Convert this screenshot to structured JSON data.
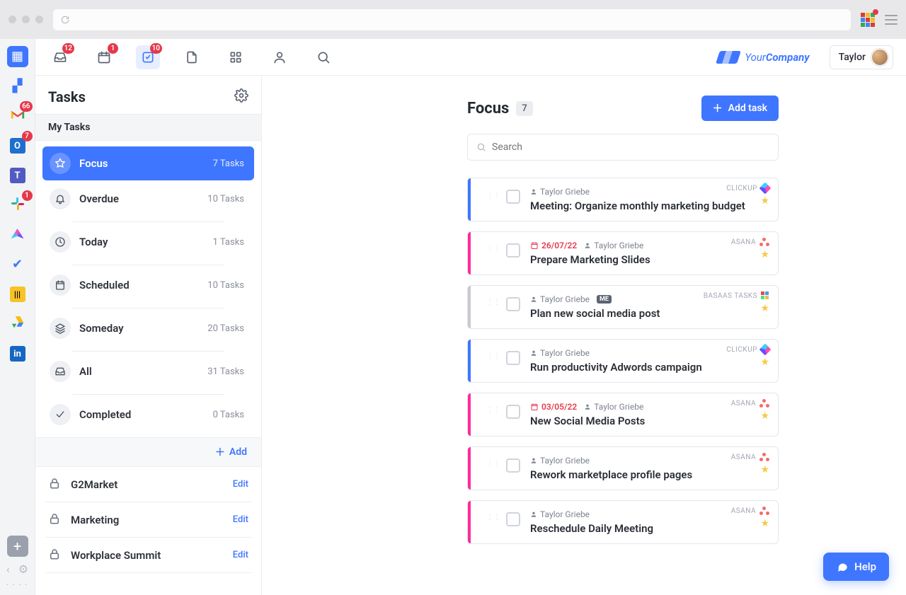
{
  "topbar": {
    "inbox_badge": "12",
    "calendar_badge": "1",
    "tasks_badge": "10",
    "brand_prefix": "Your",
    "brand_suffix": "Company",
    "user_name": "Taylor"
  },
  "rail": {
    "gmail_badge": "66",
    "outlook_badge": "7",
    "slack_badge": "1"
  },
  "sidebar": {
    "title": "Tasks",
    "section_label": "My Tasks",
    "add_label": "Add",
    "items": [
      {
        "label": "Focus",
        "count": "7 Tasks"
      },
      {
        "label": "Overdue",
        "count": "10 Tasks"
      },
      {
        "label": "Today",
        "count": "1 Tasks"
      },
      {
        "label": "Scheduled",
        "count": "10 Tasks"
      },
      {
        "label": "Someday",
        "count": "20 Tasks"
      },
      {
        "label": "All",
        "count": "31 Tasks"
      },
      {
        "label": "Completed",
        "count": "0 Tasks"
      }
    ],
    "projects": [
      {
        "name": "G2Market",
        "action": "Edit"
      },
      {
        "name": "Marketing",
        "action": "Edit"
      },
      {
        "name": "Workplace Summit",
        "action": "Edit"
      }
    ]
  },
  "content": {
    "title": "Focus",
    "count": "7",
    "add_task_label": "Add task",
    "search_placeholder": "Search",
    "tasks": [
      {
        "stripe": "blue",
        "assignee": "Taylor Griebe",
        "date": "",
        "me": false,
        "title": "Meeting: Organize monthly marketing budget",
        "source": "CLICKUP"
      },
      {
        "stripe": "pink",
        "assignee": "Taylor Griebe",
        "date": "26/07/22",
        "me": false,
        "title": "Prepare Marketing Slides",
        "source": "ASANA"
      },
      {
        "stripe": "gray",
        "assignee": "Taylor Griebe",
        "date": "",
        "me": true,
        "title": "Plan new social media post",
        "source": "BASAAS TASKS"
      },
      {
        "stripe": "blue",
        "assignee": "Taylor Griebe",
        "date": "",
        "me": false,
        "title": "Run productivity Adwords campaign",
        "source": "CLICKUP"
      },
      {
        "stripe": "pink",
        "assignee": "Taylor Griebe",
        "date": "03/05/22",
        "me": false,
        "title": "New Social Media Posts",
        "source": "ASANA"
      },
      {
        "stripe": "pink",
        "assignee": "Taylor Griebe",
        "date": "",
        "me": false,
        "title": "Rework marketplace profile pages",
        "source": "ASANA"
      },
      {
        "stripe": "pink",
        "assignee": "Taylor Griebe",
        "date": "",
        "me": false,
        "title": "Reschedule Daily Meeting",
        "source": "ASANA"
      }
    ]
  },
  "help_label": "Help",
  "me_badge_text": "ME"
}
